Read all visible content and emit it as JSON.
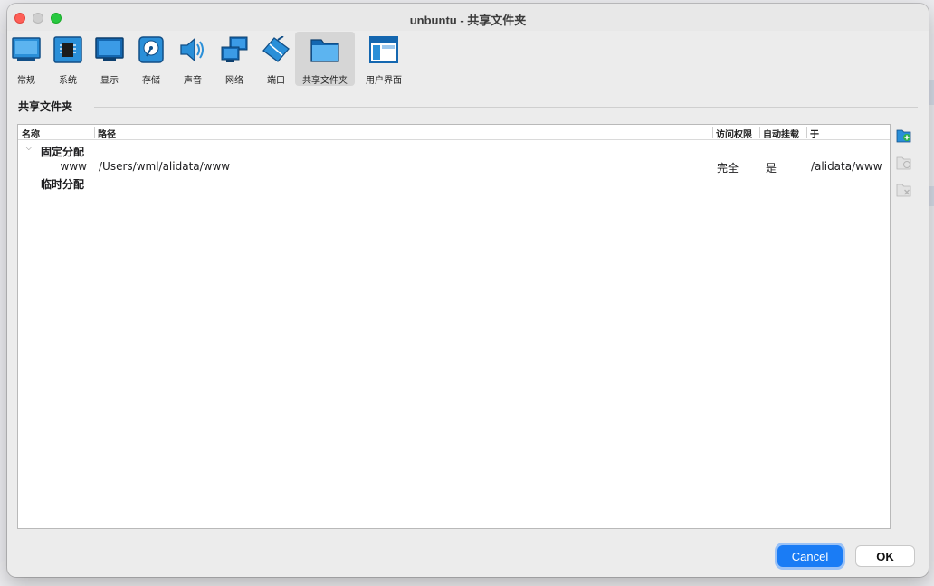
{
  "window": {
    "title": "unbuntu - 共享文件夹"
  },
  "toolbar": {
    "items": [
      {
        "label": "常规",
        "icon": "monitor-icon"
      },
      {
        "label": "系统",
        "icon": "chip-icon"
      },
      {
        "label": "显示",
        "icon": "display-icon"
      },
      {
        "label": "存储",
        "icon": "disk-icon"
      },
      {
        "label": "声音",
        "icon": "speaker-icon"
      },
      {
        "label": "网络",
        "icon": "network-icon"
      },
      {
        "label": "端口",
        "icon": "port-icon"
      },
      {
        "label": "共享文件夹",
        "icon": "folder-icon"
      },
      {
        "label": "用户界面",
        "icon": "ui-window-icon"
      }
    ],
    "active_index": 7
  },
  "section": {
    "title": "共享文件夹"
  },
  "table": {
    "columns": [
      "名称",
      "路径",
      "访问权限",
      "自动挂载",
      "于"
    ],
    "groups": [
      {
        "label": "固定分配",
        "rows": [
          {
            "name": "www",
            "path": "/Users/wml/alidata/www",
            "access": "完全",
            "automount": "是",
            "mount_point": "/alidata/www"
          }
        ]
      },
      {
        "label": "临时分配",
        "rows": []
      }
    ]
  },
  "buttons": {
    "cancel": "Cancel",
    "ok": "OK"
  },
  "colors": {
    "accent": "#1a7cf5",
    "icon_blue": "#2a8fd8"
  }
}
